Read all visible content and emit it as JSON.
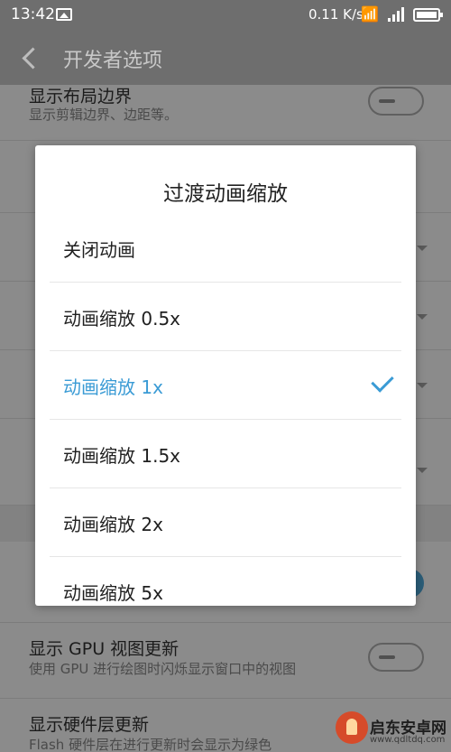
{
  "status_bar": {
    "time": "13:42",
    "net_speed": "0.11 K/s",
    "wifi_icon": "wifi-icon",
    "network_type": "4G",
    "battery_icon": "battery-icon"
  },
  "header": {
    "title": "开发者选项",
    "back_icon": "chevron-left-icon"
  },
  "settings": {
    "items": [
      {
        "title": "显示布局边界",
        "subtitle": "显示剪辑边界、边距等。"
      },
      {
        "title": "显示 GPU 视图更新",
        "subtitle": "使用 GPU 进行绘图时闪烁显示窗口中的视图"
      },
      {
        "title": "显示硬件层更新",
        "subtitle": "Flash 硬件层在进行更新时会显示为绿色"
      }
    ]
  },
  "dialog": {
    "title": "过渡动画缩放",
    "options": [
      {
        "label": "关闭动画",
        "selected": false
      },
      {
        "label": "动画缩放 0.5x",
        "selected": false
      },
      {
        "label": "动画缩放 1x",
        "selected": true
      },
      {
        "label": "动画缩放 1.5x",
        "selected": false
      },
      {
        "label": "动画缩放 2x",
        "selected": false
      },
      {
        "label": "动画缩放 5x",
        "selected": false
      }
    ],
    "accent_color": "#3a9bd5"
  },
  "watermark": {
    "name": "启东安卓网",
    "url": "www.qdltdq.com"
  }
}
